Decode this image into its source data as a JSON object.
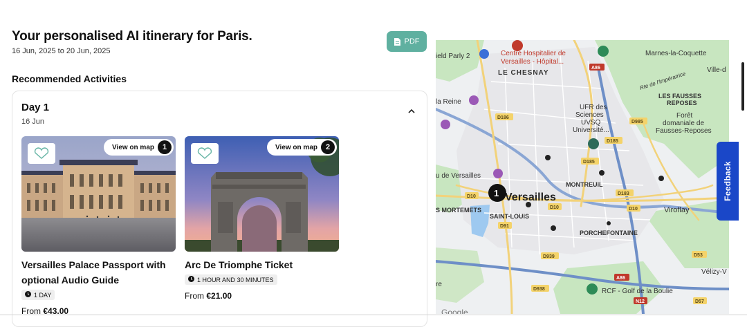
{
  "header": {
    "title": "Your personalised AI itinerary for Paris.",
    "dates": "16 Jun, 2025 to 20 Jun, 2025",
    "pdf_label": "PDF"
  },
  "section": {
    "recommended": "Recommended Activities"
  },
  "day": {
    "title": "Day 1",
    "date": "16 Jun"
  },
  "activities": [
    {
      "view_label": "View on map",
      "number": "1",
      "name": "Versailles Palace Passport with optional Audio Guide",
      "duration": "1 DAY",
      "price_prefix": "From",
      "price": "€43.00"
    },
    {
      "view_label": "View on map",
      "number": "2",
      "name": "Arc De Triomphe Ticket",
      "duration": "1 HOUR AND 30 MINUTES",
      "price_prefix": "From",
      "price": "€21.00"
    }
  ],
  "map": {
    "labels": {
      "hospital": "Centre Hospitalier de",
      "hospital2": "Versailles - Hôpital...",
      "chesnay": "LE CHESNAY",
      "marnes": "Marnes-la-Coquette",
      "ville": "Ville-d",
      "imperatrice": "Rte de l'Impératrice",
      "fausses": "LES FAUSSES",
      "reposes": "REPOSES",
      "foret1": "Forêt",
      "foret2": "domaniale de",
      "foret3": "Fausses-Reposes",
      "ufr1": "UFR des",
      "ufr2": "Sciences",
      "ufr3": "UVSQ",
      "ufr4": "Université...",
      "reine": "la Reine",
      "parly": "ield Parly 2",
      "devers": "u de Versailles",
      "versailles": "Versailles",
      "montreuil": "MONTREUIL",
      "mortemets": "S MORTEMETS",
      "saintlouis": "SAINT-LOUIS",
      "viroflay": "Viroflay",
      "porchefontaine": "PORCHEFONTAINE",
      "velizy": "Vélizy-V",
      "rcf": "RCF - Golf de la Boulie",
      "re": "re",
      "google": "Google",
      "marker": "1"
    },
    "roads": [
      "A86",
      "D186",
      "D185",
      "D10",
      "D183",
      "D91",
      "D939",
      "D938",
      "D985",
      "D53",
      "N12",
      "D57"
    ]
  },
  "feedback_label": "Feedback"
}
